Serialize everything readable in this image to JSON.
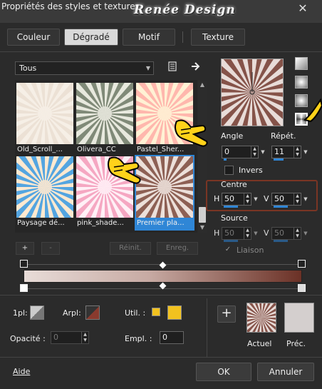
{
  "window": {
    "title": "Propriétés des styles et textures",
    "logo": "Renée Design",
    "close_label": "✕"
  },
  "tabs": [
    {
      "label": "Couleur"
    },
    {
      "label": "Dégradé",
      "active": true
    },
    {
      "label": "Motif"
    },
    {
      "label": "Texture"
    }
  ],
  "gallery": {
    "category": "Tous",
    "items": [
      {
        "label": "Old_Scroll_...",
        "colors": [
          "#f6efe6",
          "#e8dccf"
        ]
      },
      {
        "label": "Olivera_CC",
        "colors": [
          "#e8e9de",
          "#5d6a55"
        ]
      },
      {
        "label": "Pastel_Sher...",
        "colors": [
          "#fff1d4",
          "#ffa3a0"
        ]
      },
      {
        "label": "Paysage dé...",
        "colors": [
          "#ffe9d0",
          "#1b8de6"
        ]
      },
      {
        "label": "pink_shade...",
        "colors": [
          "#fff0f6",
          "#f28fb0"
        ]
      },
      {
        "label": "Premier pla...",
        "colors": [
          "#ece0da",
          "#6e3527"
        ],
        "selected": true
      }
    ],
    "add_label": "+",
    "remove_label": "-",
    "reset_label": "Réinit.",
    "save_label": "Enreg."
  },
  "controls": {
    "angle_label": "Angle",
    "angle_value": "0",
    "repeat_label": "Répét.",
    "repeat_value": "11",
    "invert_label": "Invers",
    "centre_label": "Centre",
    "centre_h_label": "H",
    "centre_h_value": "50",
    "centre_v_label": "V",
    "centre_v_value": "50",
    "source_label": "Source",
    "source_h_label": "H",
    "source_h_value": "50",
    "source_v_label": "V",
    "source_v_value": "50",
    "link_label": "Liaison"
  },
  "gradient": {
    "start_color": "#e8dcd8",
    "end_color": "#6b3126"
  },
  "bottom": {
    "opacity_label": "Opacité :",
    "opacity_value": "0",
    "fg_label": "1pl:",
    "bg_label": "Arpl:",
    "user_label": "Util. :",
    "user_color_a": "#f2c21f",
    "user_color_b": "#f2c21f",
    "location_label": "Empl. :",
    "location_value": "0",
    "current_label": "Actuel",
    "previous_label": "Préc.",
    "add_label": "+",
    "previous_color": "#d4cfce"
  },
  "footer": {
    "help_label": "Aide",
    "ok_label": "OK",
    "cancel_label": "Annuler"
  },
  "colors": {
    "accent": "#2f86d6",
    "pointer": "#ffd21a"
  }
}
